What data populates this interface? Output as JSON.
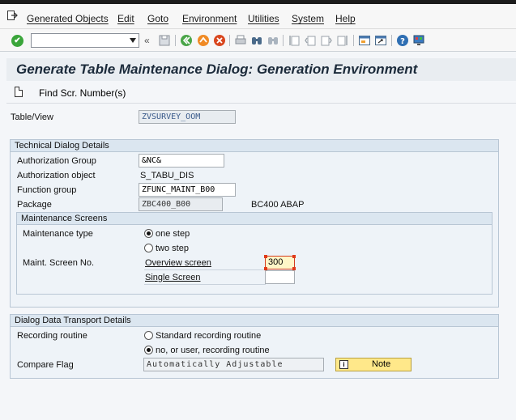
{
  "menu": [
    "Generated Objects",
    "Edit",
    "Goto",
    "Environment",
    "Utilities",
    "System",
    "Help"
  ],
  "title": "Generate Table Maintenance Dialog: Generation Environment",
  "app_toolbar": {
    "find_label": "Find Scr. Number(s)"
  },
  "table_view": {
    "label": "Table/View",
    "value": "ZVSURVEY_OOM"
  },
  "tech": {
    "title": "Technical Dialog Details",
    "auth_group_label": "Authorization Group",
    "auth_group_value": "&NC&",
    "auth_object_label": "Authorization object",
    "auth_object_value": "S_TABU_DIS",
    "function_group_label": "Function group",
    "function_group_value": "ZFUNC_MAINT_B00",
    "package_label": "Package",
    "package_value": "ZBC400_B00",
    "package_desc": "BC400 ABAP"
  },
  "maint": {
    "title": "Maintenance Screens",
    "type_label": "Maintenance type",
    "one_step": "one step",
    "two_step": "two step",
    "screen_no_label": "Maint. Screen No.",
    "overview_label": "Overview screen",
    "overview_value": "300",
    "single_label": "Single Screen",
    "single_value": ""
  },
  "transport": {
    "title": "Dialog Data Transport Details",
    "recording_label": "Recording routine",
    "standard": "Standard recording routine",
    "no_user": "no, or user, recording routine",
    "compare_label": "Compare Flag",
    "compare_value": "Automatically Adjustable",
    "note_button": "Note"
  }
}
